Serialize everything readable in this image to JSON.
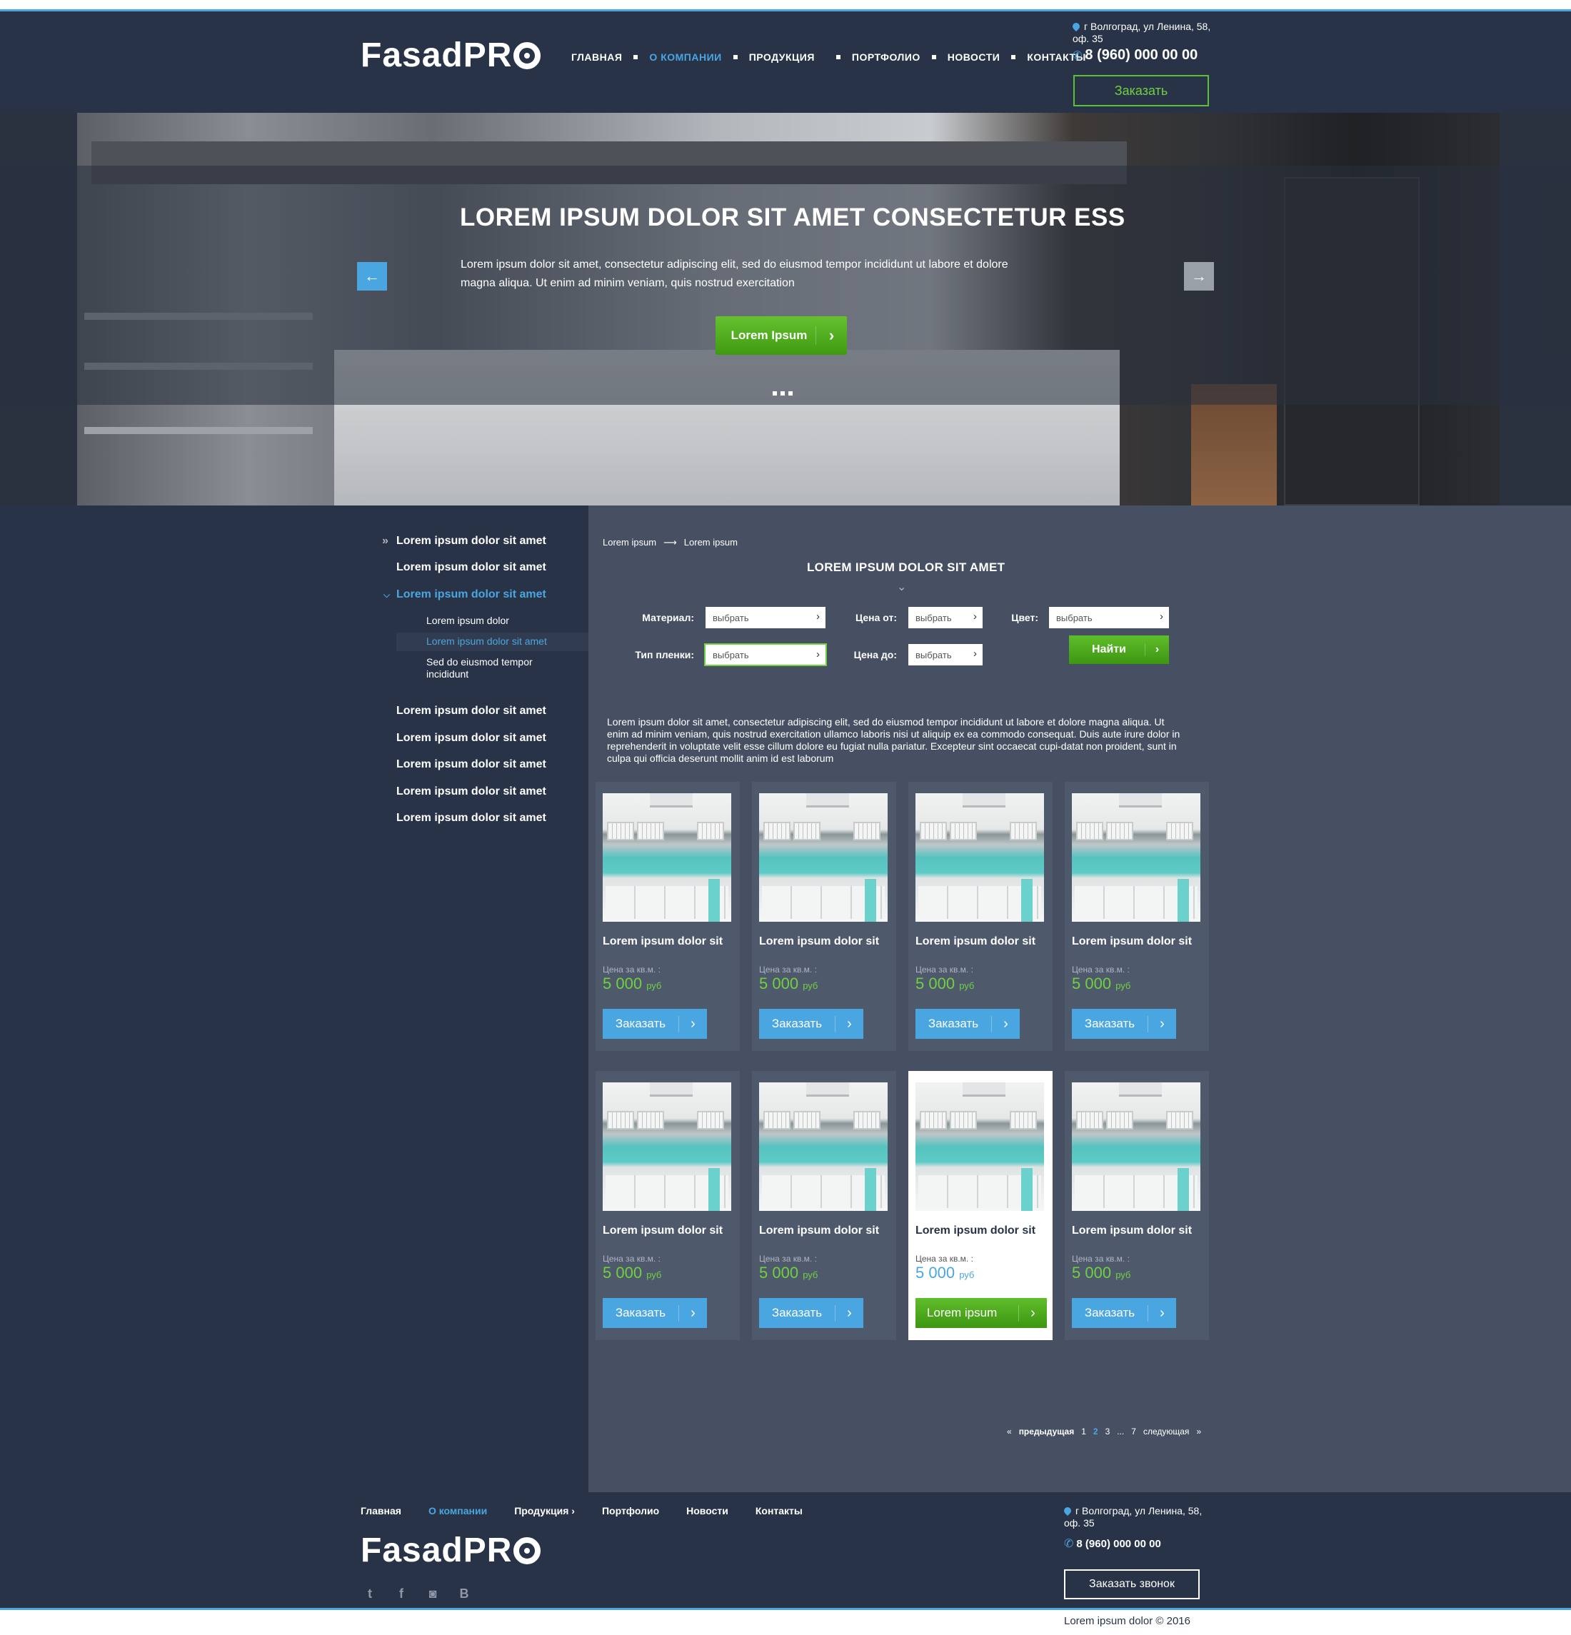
{
  "header": {
    "logo": "FasadPR",
    "nav": [
      {
        "label": "ГЛАВНАЯ"
      },
      {
        "label": "О КОМПАНИИ"
      },
      {
        "label": "ПРОДУКЦИЯ"
      },
      {
        "label": "ПОРТФОЛИО"
      },
      {
        "label": "НОВОСТИ"
      },
      {
        "label": "КОНТАКТЫ"
      }
    ],
    "address": "г Волгоград, ул Ленина, 58, оф. 35",
    "phone": "8 (960) 000 00 00",
    "order_label": "Заказать"
  },
  "hero": {
    "title": "LOREM IPSUM DOLOR SIT AMET CONSECTETUR ESS",
    "text": "Lorem ipsum dolor sit amet, consectetur adipiscing elit, sed do eiusmod tempor incididunt ut labore et dolore magna aliqua. Ut enim ad minim veniam, quis nostrud exercitation",
    "button_label": "Lorem Ipsum"
  },
  "sidebar": {
    "items": [
      {
        "label": "Lorem ipsum dolor sit amet"
      },
      {
        "label": "Lorem ipsum dolor sit amet"
      },
      {
        "label": "Lorem ipsum dolor sit amet"
      },
      {
        "label": "Lorem ipsum dolor sit amet"
      },
      {
        "label": "Lorem ipsum dolor sit amet"
      },
      {
        "label": "Lorem ipsum dolor sit amet"
      },
      {
        "label": "Lorem ipsum dolor sit amet"
      },
      {
        "label": "Lorem ipsum dolor sit amet"
      }
    ],
    "subitems": [
      {
        "label": "Lorem ipsum dolor"
      },
      {
        "label": "Lorem ipsum dolor sit amet"
      },
      {
        "label": "Sed do eiusmod tempor incididunt"
      }
    ]
  },
  "breadcrumb": [
    "Lorem ipsum",
    "Lorem ipsum"
  ],
  "section_title": "LOREM IPSUM DOLOR SIT AMET",
  "filters": {
    "material_label": "Материал:",
    "film_label": "Тип пленки:",
    "price_from_label": "Цена от:",
    "price_to_label": "Цена до:",
    "color_label": "Цвет:",
    "select_value": "выбрать",
    "find_label": "Найти"
  },
  "intro_text": "Lorem ipsum dolor sit amet, consectetur adipiscing elit, sed do eiusmod tempor incididunt ut labore et dolore magna aliqua. Ut enim ad minim veniam, quis nostrud exercitation ullamco laboris nisi ut aliquip ex ea commodo consequat. Duis aute irure dolor in reprehenderit in voluptate velit esse cillum dolore eu fugiat nulla pariatur. Excepteur sint occaecat cupi-datat non proident, sunt in culpa qui officia deserunt mollit anim id est laborum",
  "products": [
    {
      "name": "Lorem ipsum dolor sit",
      "price_label": "Цена за кв.м. :",
      "price": "5 000",
      "currency": "руб",
      "button": "Заказать"
    },
    {
      "name": "Lorem ipsum dolor sit",
      "price_label": "Цена за кв.м. :",
      "price": "5 000",
      "currency": "руб",
      "button": "Заказать"
    },
    {
      "name": "Lorem ipsum dolor sit",
      "price_label": "Цена за кв.м. :",
      "price": "5 000",
      "currency": "руб",
      "button": "Заказать"
    },
    {
      "name": "Lorem ipsum dolor sit",
      "price_label": "Цена за кв.м. :",
      "price": "5 000",
      "currency": "руб",
      "button": "Заказать"
    },
    {
      "name": "Lorem ipsum dolor sit",
      "price_label": "Цена за кв.м. :",
      "price": "5 000",
      "currency": "руб",
      "button": "Заказать"
    },
    {
      "name": "Lorem ipsum dolor sit",
      "price_label": "Цена за кв.м. :",
      "price": "5 000",
      "currency": "руб",
      "button": "Заказать"
    },
    {
      "name": "Lorem ipsum dolor sit",
      "price_label": "Цена за кв.м. :",
      "price": "5 000",
      "currency": "руб",
      "button": "Lorem ipsum"
    },
    {
      "name": "Lorem ipsum dolor sit",
      "price_label": "Цена за кв.м. :",
      "price": "5 000",
      "currency": "руб",
      "button": "Заказать"
    }
  ],
  "pagination": {
    "prev": "предыдущая",
    "pages": [
      "1",
      "2",
      "3",
      "...",
      "7"
    ],
    "next": "следующая"
  },
  "footer": {
    "nav": [
      {
        "label": "Главная"
      },
      {
        "label": "О компании"
      },
      {
        "label": "Продукция"
      },
      {
        "label": "Портфолио"
      },
      {
        "label": "Новости"
      },
      {
        "label": "Контакты"
      }
    ],
    "logo": "FasadPR",
    "address": "г Волгоград, ул Ленина, 58, оф. 35",
    "phone": "8 (960) 000 00 00",
    "call_label": "Заказать звонок",
    "copyright": "Lorem ipsum dolor © 2016"
  },
  "colors": {
    "accent": "#4aa6e0",
    "green": "#5bc236",
    "dark": "#283347",
    "panel": "#475063"
  },
  "icons": [
    "map-pin-icon",
    "phone-icon",
    "arrow-left-icon",
    "arrow-right-icon",
    "chevron-right-icon",
    "twitter-icon",
    "facebook-icon",
    "instagram-icon",
    "vk-icon"
  ]
}
